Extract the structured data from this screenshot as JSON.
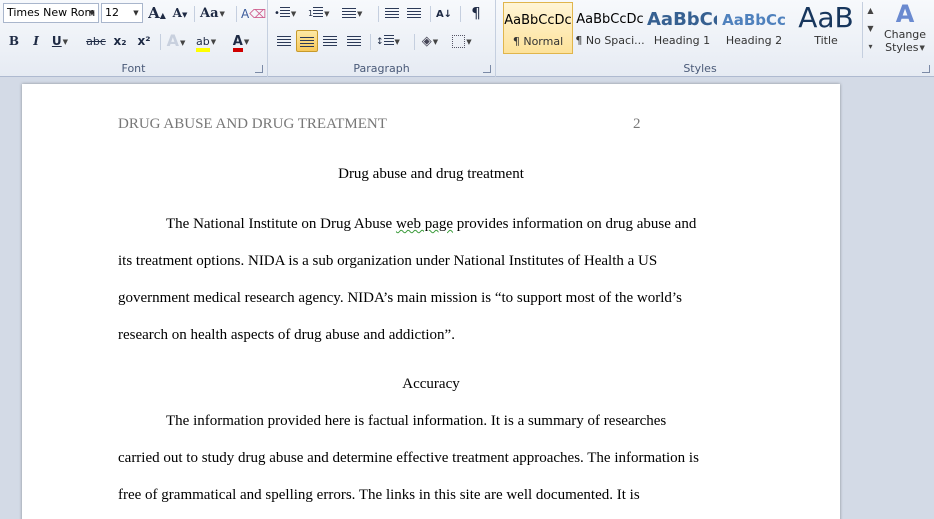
{
  "font": {
    "name": "Times New Rom",
    "size": "12",
    "grow_label": "A",
    "shrink_label": "A",
    "case_label": "Aa",
    "bold": "B",
    "italic": "I",
    "underline": "U",
    "strike": "abc",
    "subscript": "x₂",
    "superscript": "x²",
    "highlight": "ab",
    "color_letter": "A",
    "group_label": "Font"
  },
  "paragraph": {
    "group_label": "Paragraph",
    "pilcrow": "¶"
  },
  "styles": {
    "group_label": "Styles",
    "items": [
      {
        "sample": "AaBbCcDc",
        "name": "¶ Normal"
      },
      {
        "sample": "AaBbCcDc",
        "name": "¶ No Spaci..."
      },
      {
        "sample": "AaBbCc",
        "name": "Heading 1"
      },
      {
        "sample": "AaBbCc",
        "name": "Heading 2"
      },
      {
        "sample": "AaB",
        "name": "Title"
      }
    ],
    "change_label_1": "Change",
    "change_label_2": "Styles"
  },
  "colors": {
    "highlight": "#ffff00",
    "font_color": "#d00000",
    "heading": "#366091"
  },
  "document": {
    "header": "DRUG ABUSE AND DRUG TREATMENT",
    "page_number": "2",
    "title": "Drug abuse and drug treatment",
    "p1_l1_a": "The National Institute on Drug Abuse ",
    "p1_l1_b": "web  page",
    "p1_l1_c": " provides information on drug abuse and",
    "p1_l2": "its treatment options. NIDA is a sub organization under National Institutes of Health a US",
    "p1_l3": "government medical research agency. NIDA’s main mission is “to support most of the world’s",
    "p1_l4": "research on health aspects of drug abuse and addiction”.",
    "heading2": "Accuracy",
    "p2_l1": "The information provided here is factual information. It is a summary of researches",
    "p2_l2": "carried out to study drug abuse and determine effective treatment approaches. The information is",
    "p2_l3": "free of grammatical and spelling errors. The links in this site are well documented. It is"
  }
}
